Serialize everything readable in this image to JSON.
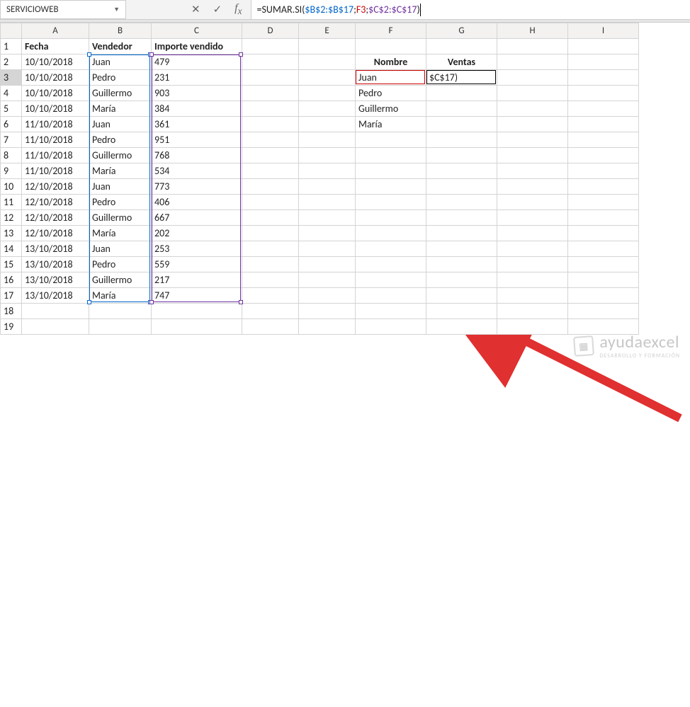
{
  "nameBox": "SERVICIOWEB",
  "formula": {
    "prefix": "=SUMAR.SI(",
    "rngB": "$B$2:$B$17",
    "sep1": ";",
    "rngF": "F3",
    "sep2": ";",
    "rngC": "$C$2:$C$17",
    "suffix": ")"
  },
  "colLabels": [
    "A",
    "B",
    "C",
    "D",
    "E",
    "F",
    "G",
    "H",
    "I"
  ],
  "rowCount": 19,
  "headers": {
    "A": "Fecha",
    "B": "Vendedor",
    "C": "Importe vendido"
  },
  "rows": [
    {
      "A": "10/10/2018",
      "B": "Juan",
      "C": "479"
    },
    {
      "A": "10/10/2018",
      "B": "Pedro",
      "C": "231"
    },
    {
      "A": "10/10/2018",
      "B": "Guillermo",
      "C": "903"
    },
    {
      "A": "10/10/2018",
      "B": "María",
      "C": "384"
    },
    {
      "A": "11/10/2018",
      "B": "Juan",
      "C": "361"
    },
    {
      "A": "11/10/2018",
      "B": "Pedro",
      "C": "951"
    },
    {
      "A": "11/10/2018",
      "B": "Guillermo",
      "C": "768"
    },
    {
      "A": "11/10/2018",
      "B": "María",
      "C": "534"
    },
    {
      "A": "12/10/2018",
      "B": "Juan",
      "C": "773"
    },
    {
      "A": "12/10/2018",
      "B": "Pedro",
      "C": "406"
    },
    {
      "A": "12/10/2018",
      "B": "Guillermo",
      "C": "667"
    },
    {
      "A": "12/10/2018",
      "B": "María",
      "C": "202"
    },
    {
      "A": "13/10/2018",
      "B": "Juan",
      "C": "253"
    },
    {
      "A": "13/10/2018",
      "B": "Pedro",
      "C": "559"
    },
    {
      "A": "13/10/2018",
      "B": "Guillermo",
      "C": "217"
    },
    {
      "A": "13/10/2018",
      "B": "María",
      "C": "747"
    }
  ],
  "sideHeaders": {
    "F": "Nombre",
    "G": "Ventas"
  },
  "sideRows": [
    {
      "F": "Juan",
      "G": "$C$17)"
    },
    {
      "F": "Pedro"
    },
    {
      "F": "Guillermo"
    },
    {
      "F": "María"
    }
  ],
  "watermark": {
    "brand": "ayudaexcel",
    "sub": "DESARROLLO Y FORMACIÓN"
  }
}
